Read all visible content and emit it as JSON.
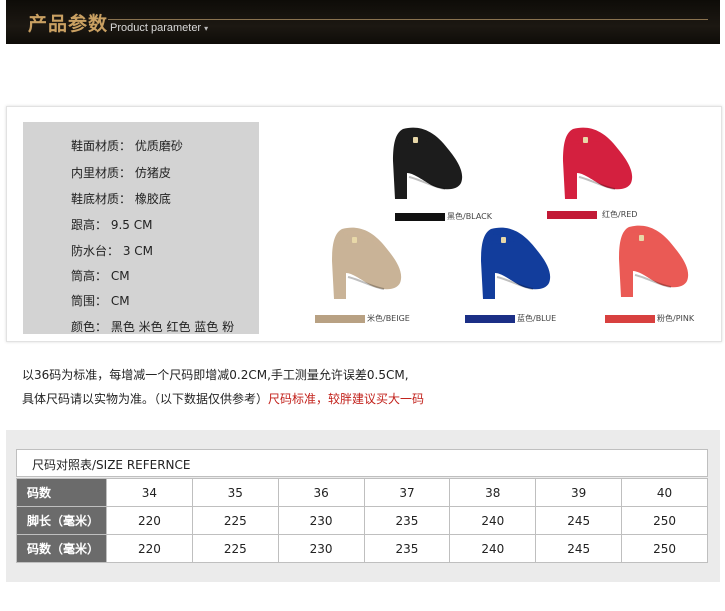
{
  "header": {
    "title_zh": "产品参数",
    "title_en": "Product parameter",
    "arrow": "▾"
  },
  "specs": [
    "鞋面材质：  优质磨砂",
    "内里材质：  仿猪皮",
    "鞋底材质：  橡胶底",
    "跟高：   9.5  CM",
    "防水台：  3   CM",
    "筒高：        CM",
    "筒围：        CM",
    "颜色：  黑色 米色 红色 蓝色 粉"
  ],
  "shoes": [
    {
      "label": "黑色/BLACK",
      "color": "#1c1c1c",
      "swatch": "#111111"
    },
    {
      "label": "红色/RED",
      "color": "#d4203f",
      "swatch": "#c21a36"
    },
    {
      "label": "米色/BEIGE",
      "color": "#c9b397",
      "swatch": "#b8a183"
    },
    {
      "label": "蓝色/BLUE",
      "color": "#123d9c",
      "swatch": "#1b2f86"
    },
    {
      "label": "粉色/PINK",
      "color": "#ea5a55",
      "swatch": "#d8403f"
    }
  ],
  "notes": {
    "line1": "以36码为标准，每增减一个尺码即增减0.2CM,手工测量允许误差0.5CM,",
    "line2_a": "具体尺码请以实物为准。（以下数据仅供参考）",
    "line2_b": "尺码标准，较胖建议买大一码"
  },
  "size_table": {
    "title": "尺码对照表/SIZE  REFERNCE",
    "rows": [
      {
        "label": "码数",
        "values": [
          "34",
          "35",
          "36",
          "37",
          "38",
          "39",
          "40"
        ]
      },
      {
        "label": "脚长（毫米）",
        "values": [
          "220",
          "225",
          "230",
          "235",
          "240",
          "245",
          "250"
        ]
      },
      {
        "label": "码数（毫米）",
        "values": [
          "220",
          "225",
          "230",
          "235",
          "240",
          "245",
          "250"
        ]
      }
    ]
  }
}
